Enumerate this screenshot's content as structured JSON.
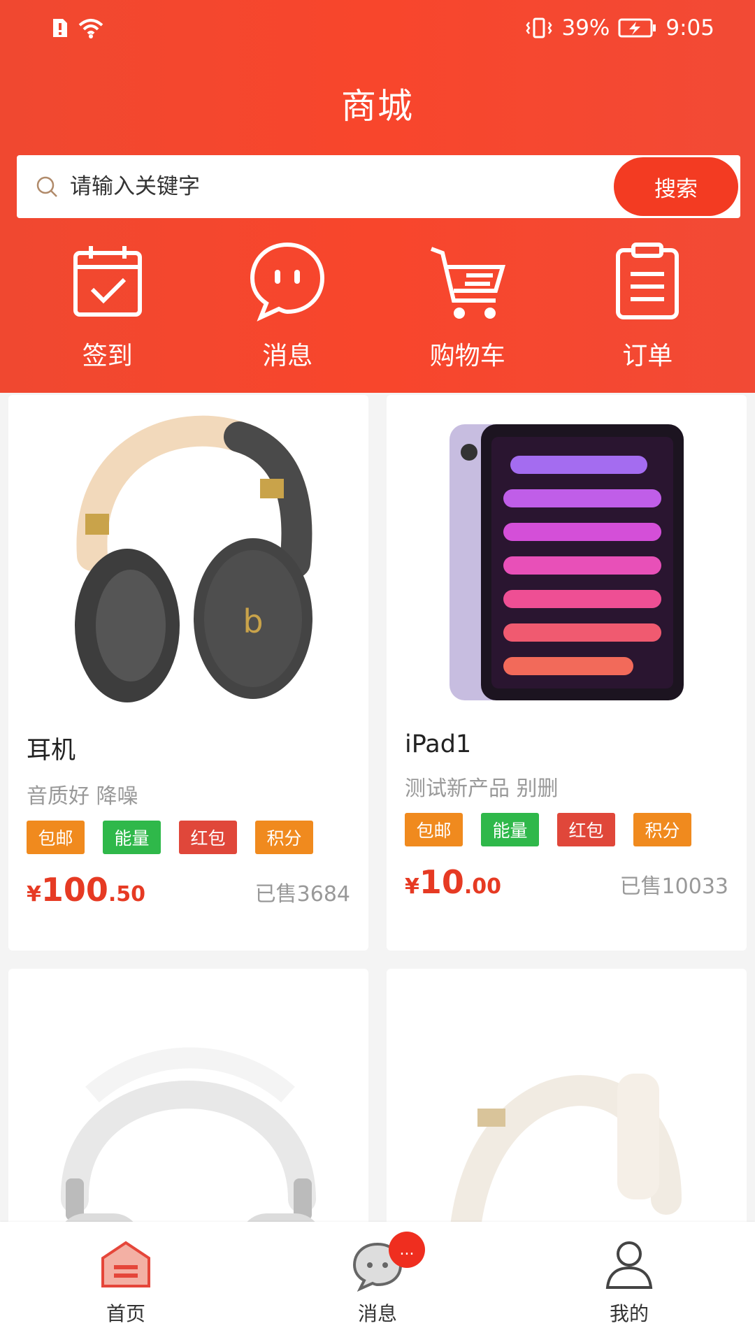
{
  "status": {
    "battery": "39%",
    "time": "9:05"
  },
  "header": {
    "title": "商城",
    "search_placeholder": "请输入关键字",
    "search_button": "搜索"
  },
  "quick_nav": [
    {
      "label": "签到",
      "icon": "calendar-check-icon"
    },
    {
      "label": "消息",
      "icon": "chat-bubble-icon"
    },
    {
      "label": "购物车",
      "icon": "cart-icon"
    },
    {
      "label": "订单",
      "icon": "clipboard-icon"
    }
  ],
  "tag_colors": {
    "包邮": "#f08a1e",
    "能量": "#2fb84a",
    "红包": "#e0473a",
    "积分": "#f08a1e"
  },
  "products": [
    {
      "name": "耳机",
      "desc": "音质好 降噪",
      "tags": [
        "包邮",
        "能量",
        "红包",
        "积分"
      ],
      "currency": "¥",
      "price_int": "100",
      "price_dec": ".50",
      "sold": "已售3684"
    },
    {
      "name": "iPad1",
      "desc": "测试新产品 别删",
      "tags": [
        "包邮",
        "能量",
        "红包",
        "积分"
      ],
      "currency": "¥",
      "price_int": "10",
      "price_dec": ".00",
      "sold": "已售10033"
    }
  ],
  "tabbar": {
    "items": [
      {
        "label": "首页",
        "icon": "home-icon",
        "active": true
      },
      {
        "label": "消息",
        "icon": "message-icon",
        "badge": "..."
      },
      {
        "label": "我的",
        "icon": "user-icon"
      }
    ]
  },
  "colors": {
    "brand": "#f33b22",
    "price": "#e63a23"
  }
}
